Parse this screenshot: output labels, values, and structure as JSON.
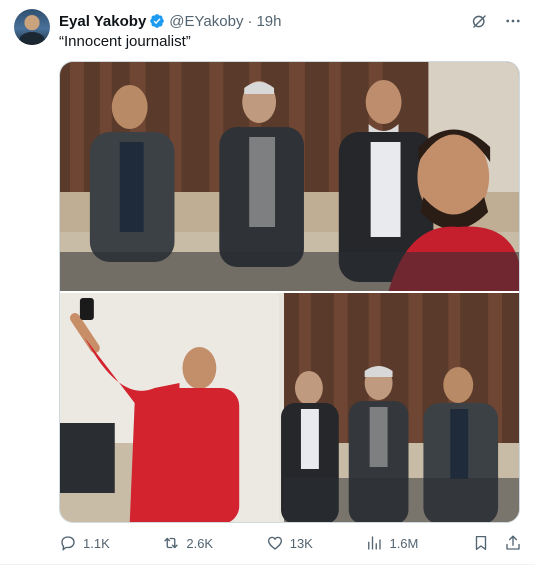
{
  "tweet": {
    "author": {
      "name": "Eyal Yakoby",
      "handle": "@EYakoby",
      "verified_icon": "verified-badge-icon",
      "avatar_icon": "avatar"
    },
    "separator": "·",
    "time": "19h",
    "text": "“Innocent journalist”",
    "top_icons": [
      "grok-icon",
      "more-icon"
    ],
    "media": {
      "photos": [
        "photo-top",
        "photo-bottom"
      ]
    },
    "stats": {
      "replies": "1.1K",
      "reposts": "2.6K",
      "likes": "13K",
      "views": "1.6M"
    },
    "colors": {
      "text_primary": "#0f1419",
      "text_secondary": "#536471",
      "verified": "#1d9bf0",
      "border": "#cfd9de"
    }
  }
}
